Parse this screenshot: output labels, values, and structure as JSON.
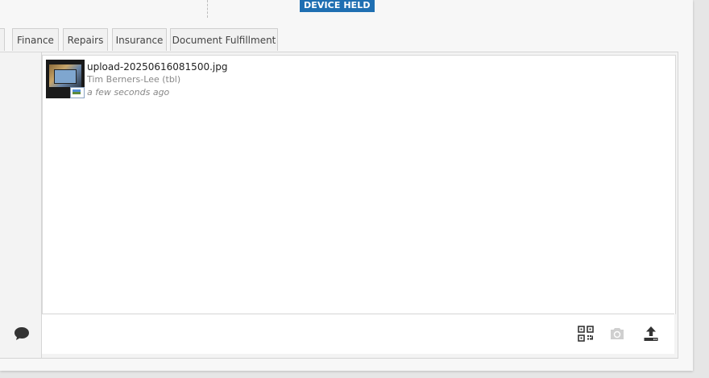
{
  "header": {
    "status_badge": "DEVICE HELD"
  },
  "tabs": [
    {
      "label": "Finance"
    },
    {
      "label": "Repairs"
    },
    {
      "label": "Insurance"
    },
    {
      "label": "Document Fulfillment"
    }
  ],
  "files": [
    {
      "name": "upload-20250616081500.jpg",
      "user": "Tim Berners-Lee (tbl)",
      "time": "a few seconds ago"
    }
  ],
  "icons": {
    "comment": "comment-icon",
    "qr": "qr-code-icon",
    "camera": "camera-icon",
    "upload": "upload-icon"
  },
  "colors": {
    "badge": "#1f6fb2",
    "comment_icon": "#333333",
    "camera_disabled": "#cccccc"
  }
}
